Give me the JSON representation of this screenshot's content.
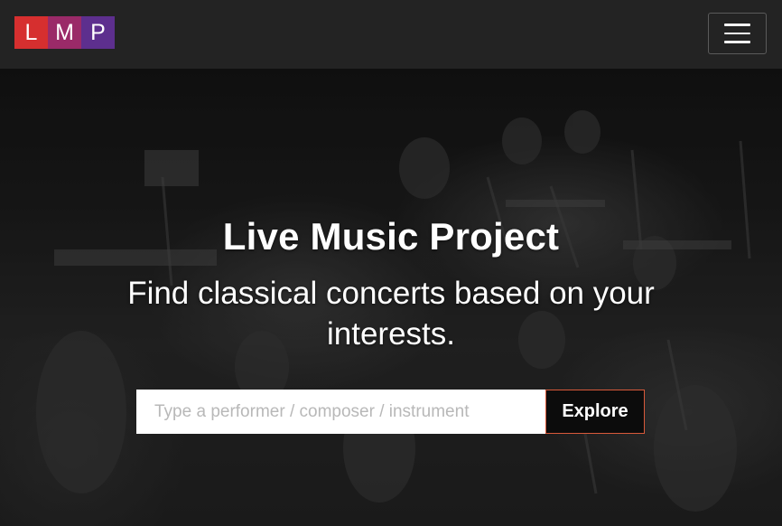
{
  "navbar": {
    "logo_letters": [
      "L",
      "M",
      "P"
    ],
    "logo_colors": [
      "#d62f2f",
      "#9a2a68",
      "#5d2f8e"
    ],
    "menu_icon": "hamburger-menu-icon"
  },
  "hero": {
    "background": "black-and-white photo of orchestra musicians rehearsing on stage",
    "title": "Live Music Project",
    "subtitle": "Find classical concerts based on your interests."
  },
  "search": {
    "placeholder": "Type a performer / composer / instrument",
    "value": "",
    "button_label": "Explore"
  },
  "colors": {
    "navbar_bg": "#232323",
    "button_border": "#d8593a"
  }
}
